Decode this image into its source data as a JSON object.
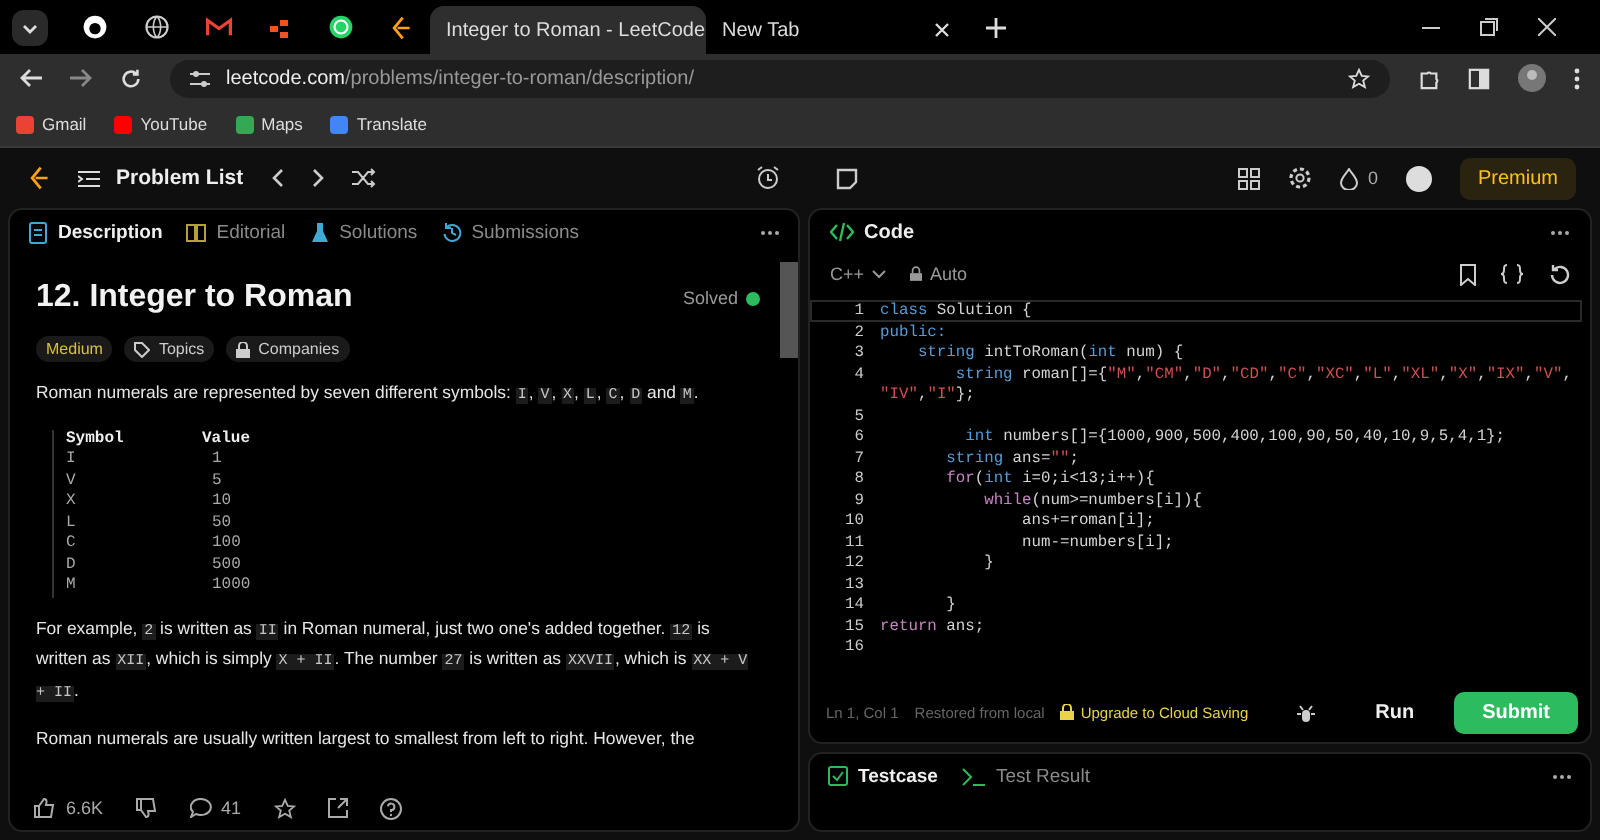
{
  "browser": {
    "tabs": [
      {
        "title": "Integer to Roman - LeetCode",
        "selected": true
      },
      {
        "title": "New Tab",
        "selected": false
      }
    ],
    "url": {
      "host": "leetcode.com",
      "path": "/problems/integer-to-roman/description/"
    },
    "bookmarks": [
      "Gmail",
      "YouTube",
      "Maps",
      "Translate"
    ]
  },
  "app_bar": {
    "problem_list": "Problem List",
    "streak": "0",
    "premium": "Premium"
  },
  "description_panel": {
    "tabs": [
      {
        "label": "Description",
        "selected": true
      },
      {
        "label": "Editorial",
        "selected": false
      },
      {
        "label": "Solutions",
        "selected": false
      },
      {
        "label": "Submissions",
        "selected": false
      }
    ],
    "title": "12. Integer to Roman",
    "status": "Solved",
    "difficulty": "Medium",
    "tags": [
      "Topics",
      "Companies"
    ],
    "intro": [
      {
        "kind": "text",
        "text": "Roman numerals are represented by seven different symbols: "
      },
      {
        "kind": "code",
        "text": "I"
      },
      {
        "kind": "text",
        "text": ", "
      },
      {
        "kind": "code",
        "text": "V"
      },
      {
        "kind": "text",
        "text": ", "
      },
      {
        "kind": "code",
        "text": "X"
      },
      {
        "kind": "text",
        "text": ", "
      },
      {
        "kind": "code",
        "text": "L"
      },
      {
        "kind": "text",
        "text": ", "
      },
      {
        "kind": "code",
        "text": "C"
      },
      {
        "kind": "text",
        "text": ", "
      },
      {
        "kind": "code",
        "text": "D"
      },
      {
        "kind": "text",
        "text": " and "
      },
      {
        "kind": "code",
        "text": "M"
      },
      {
        "kind": "text",
        "text": "."
      }
    ],
    "symbol_table": {
      "columns": [
        "Symbol",
        "Value"
      ],
      "rows": [
        [
          "I",
          "1"
        ],
        [
          "V",
          "5"
        ],
        [
          "X",
          "10"
        ],
        [
          "L",
          "50"
        ],
        [
          "C",
          "100"
        ],
        [
          "D",
          "500"
        ],
        [
          "M",
          "1000"
        ]
      ]
    },
    "paragraphs": [
      [
        {
          "kind": "text",
          "text": "For example, "
        },
        {
          "kind": "code",
          "text": "2"
        },
        {
          "kind": "text",
          "text": " is written as "
        },
        {
          "kind": "code",
          "text": "II"
        },
        {
          "kind": "text",
          "text": " in Roman numeral, just two one's added together. "
        },
        {
          "kind": "code",
          "text": "12"
        },
        {
          "kind": "text",
          "text": " is written as "
        },
        {
          "kind": "code",
          "text": "XII"
        },
        {
          "kind": "text",
          "text": ", which is simply "
        },
        {
          "kind": "code",
          "text": "X + II"
        },
        {
          "kind": "text",
          "text": ". The number "
        },
        {
          "kind": "code",
          "text": "27"
        },
        {
          "kind": "text",
          "text": " is written as "
        },
        {
          "kind": "code",
          "text": "XXVII"
        },
        {
          "kind": "text",
          "text": ", which is "
        },
        {
          "kind": "code",
          "text": "XX + V + II"
        },
        {
          "kind": "text",
          "text": "."
        }
      ],
      [
        {
          "kind": "text",
          "text": "Roman numerals are usually written largest to smallest from left to right. However, the"
        }
      ]
    ],
    "footer": {
      "likes": "6.6K",
      "comments": "41"
    }
  },
  "code_panel": {
    "title": "Code",
    "language": "C++",
    "mode": "Auto",
    "lines": [
      {
        "number": "1",
        "segments": [
          {
            "kind": "kw",
            "text": "class"
          },
          {
            "kind": "plain",
            "text": " Solution {"
          }
        ]
      },
      {
        "number": "2",
        "segments": [
          {
            "kind": "kw",
            "text": "public:"
          }
        ]
      },
      {
        "number": "3",
        "segments": [
          {
            "kind": "kw",
            "text": "    string"
          },
          {
            "kind": "plain",
            "text": " intToRoman("
          },
          {
            "kind": "kw",
            "text": "int"
          },
          {
            "kind": "plain",
            "text": " num) {"
          }
        ]
      },
      {
        "number": "4",
        "segments": [
          {
            "kind": "kw",
            "text": "        string"
          },
          {
            "kind": "plain",
            "text": " roman[]={"
          },
          {
            "kind": "str",
            "text": "\"M\""
          },
          {
            "kind": "plain",
            "text": ","
          },
          {
            "kind": "str",
            "text": "\"CM\""
          },
          {
            "kind": "plain",
            "text": ","
          },
          {
            "kind": "str",
            "text": "\"D\""
          },
          {
            "kind": "plain",
            "text": ","
          },
          {
            "kind": "str",
            "text": "\"CD\""
          },
          {
            "kind": "plain",
            "text": ","
          },
          {
            "kind": "str",
            "text": "\"C\""
          },
          {
            "kind": "plain",
            "text": ","
          },
          {
            "kind": "str",
            "text": "\"XC\""
          },
          {
            "kind": "plain",
            "text": ","
          },
          {
            "kind": "str",
            "text": "\"L\""
          },
          {
            "kind": "plain",
            "text": ","
          },
          {
            "kind": "str",
            "text": "\"XL\""
          },
          {
            "kind": "plain",
            "text": ","
          },
          {
            "kind": "str",
            "text": "\"X\""
          },
          {
            "kind": "plain",
            "text": ","
          },
          {
            "kind": "str",
            "text": "\"IX\""
          },
          {
            "kind": "plain",
            "text": ","
          },
          {
            "kind": "str",
            "text": "\"V\""
          },
          {
            "kind": "plain",
            "text": ","
          }
        ]
      },
      {
        "segments": [
          {
            "kind": "str",
            "text": "\"IV\""
          },
          {
            "kind": "plain",
            "text": ","
          },
          {
            "kind": "str",
            "text": "\"I\""
          },
          {
            "kind": "plain",
            "text": "};"
          }
        ]
      },
      {
        "number": "5"
      },
      {
        "number": "6",
        "segments": [
          {
            "kind": "kw",
            "text": "         int"
          },
          {
            "kind": "plain",
            "text": " numbers[]={1000,900,500,400,100,90,50,40,10,9,5,4,1};"
          }
        ]
      },
      {
        "number": "7",
        "segments": [
          {
            "kind": "kw",
            "text": "       string"
          },
          {
            "kind": "plain",
            "text": " ans="
          },
          {
            "kind": "str",
            "text": "\"\""
          },
          {
            "kind": "plain",
            "text": ";"
          }
        ]
      },
      {
        "number": "8",
        "segments": [
          {
            "kind": "ctrl",
            "text": "       for"
          },
          {
            "kind": "plain",
            "text": "("
          },
          {
            "kind": "kw",
            "text": "int"
          },
          {
            "kind": "plain",
            "text": " i=0;i<13;i++){"
          }
        ]
      },
      {
        "number": "9",
        "segments": [
          {
            "kind": "ctrl",
            "text": "           while"
          },
          {
            "kind": "plain",
            "text": "(num>=numbers[i]){"
          }
        ]
      },
      {
        "number": "10",
        "segments": [
          {
            "kind": "plain",
            "text": "               ans+=roman[i];"
          }
        ]
      },
      {
        "number": "11",
        "segments": [
          {
            "kind": "plain",
            "text": "               num-=numbers[i];"
          }
        ]
      },
      {
        "number": "12",
        "segments": [
          {
            "kind": "plain",
            "text": "           }"
          }
        ]
      },
      {
        "number": "13"
      },
      {
        "number": "14",
        "segments": [
          {
            "kind": "plain",
            "text": "       }"
          }
        ]
      },
      {
        "number": "15",
        "segments": [
          {
            "kind": "ctrl",
            "text": "return"
          },
          {
            "kind": "plain",
            "text": " ans;"
          }
        ]
      },
      {
        "number": "16"
      }
    ],
    "status": {
      "position": "Ln 1, Col 1",
      "restore": "Restored from local",
      "upgrade": "Upgrade to Cloud Saving"
    },
    "run": "Run",
    "submit": "Submit"
  },
  "bottom_panel": {
    "tabs": [
      {
        "label": "Testcase",
        "selected": true
      },
      {
        "label": "Test Result",
        "selected": false
      }
    ]
  }
}
